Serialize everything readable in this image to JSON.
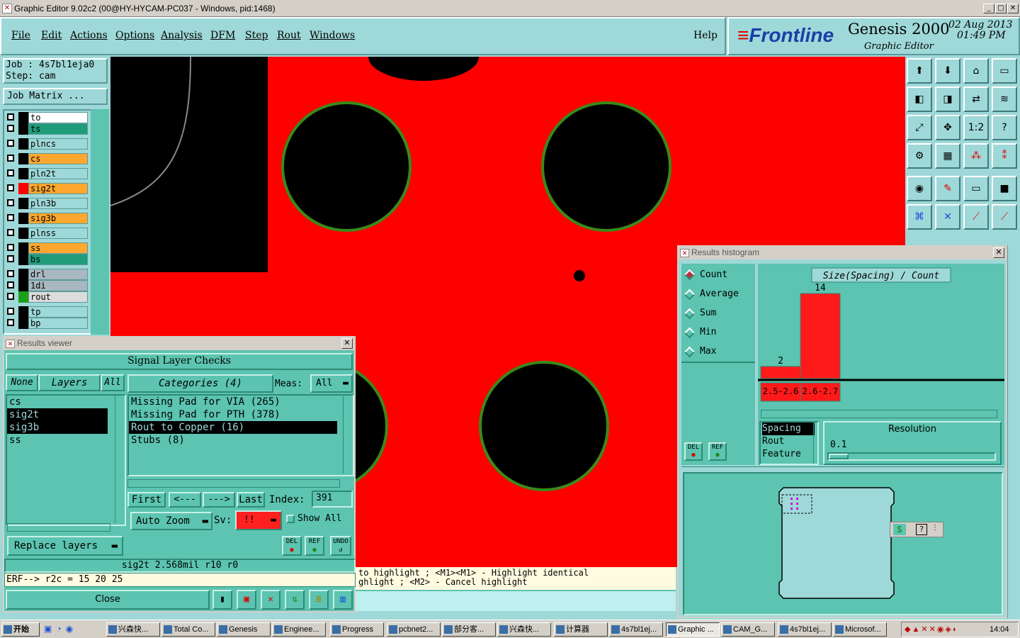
{
  "window": {
    "title": "Graphic Editor 9.02c2 (00@HY-HYCAM-PC037 - Windows, pid:1468)",
    "min": "_",
    "max": "□",
    "close": "✕"
  },
  "menu": {
    "items": [
      "File",
      "Edit",
      "Actions",
      "Options",
      "Analysis",
      "DFM",
      "Step",
      "Rout",
      "Windows"
    ],
    "help": "Help"
  },
  "brand": {
    "logo": "Frontline",
    "product": "Genesis 2000",
    "subtitle": "Graphic Editor",
    "date": "02  Aug 2013",
    "time": "01:49  PM"
  },
  "job": {
    "job_label": "Job : 4s7bl1eja0",
    "step_label": "Step: cam",
    "matrix_button": "Job Matrix ..."
  },
  "layers": [
    {
      "name": "to",
      "bg": "#ffffff",
      "swatch": "#000000"
    },
    {
      "name": "ts",
      "bg": "#1f9c7a",
      "swatch": "#000000"
    },
    {
      "name": "plncs",
      "bg": "#9fd8d8",
      "swatch": "#000000"
    },
    {
      "name": "cs",
      "bg": "#ffa72e",
      "swatch": "#000000"
    },
    {
      "name": "pln2t",
      "bg": "#9fd8d8",
      "swatch": "#000000"
    },
    {
      "name": "sig2t",
      "bg": "#ffa72e",
      "swatch": "#ff0000"
    },
    {
      "name": "pln3b",
      "bg": "#9fd8d8",
      "swatch": "#000000"
    },
    {
      "name": "sig3b",
      "bg": "#ffa72e",
      "swatch": "#000000"
    },
    {
      "name": "plnss",
      "bg": "#9fd8d8",
      "swatch": "#000000"
    },
    {
      "name": "ss",
      "bg": "#ffa72e",
      "swatch": "#000000"
    },
    {
      "name": "bs",
      "bg": "#1f9c7a",
      "swatch": "#000000"
    },
    {
      "name": "drl",
      "bg": "#a8b8c0",
      "swatch": "#000000"
    },
    {
      "name": "1di",
      "bg": "#a8b8c0",
      "swatch": "#000000"
    },
    {
      "name": "rout",
      "bg": "#dcdcdc",
      "swatch": "#1aa01a"
    },
    {
      "name": "tp",
      "bg": "#9fd8d8",
      "swatch": "#000000"
    },
    {
      "name": "bp",
      "bg": "#9fd8d8",
      "swatch": "#000000"
    }
  ],
  "results_viewer": {
    "title": "Results viewer",
    "heading": "Signal Layer Checks",
    "none_btn": "None",
    "layers_btn": "Layers",
    "all_btn": "All",
    "categories_btn": "Categories (4)",
    "meas_label": "Meas:",
    "meas_value": "All",
    "layer_list": [
      "cs",
      "sig2t",
      "sig3b",
      "ss"
    ],
    "categories": [
      "Missing Pad for VIA (265)",
      "Missing Pad for PTH (378)",
      "Rout to Copper (16)",
      "Stubs (8)"
    ],
    "first": "First",
    "prev": "<---",
    "next": "--->",
    "last": "Last",
    "index_label": "Index:",
    "index_value": "391",
    "auto_zoom": "Auto Zoom",
    "sv_label": "Sv:",
    "sv_value": "!!",
    "show_all": "Show All",
    "replace_layers": "Replace layers",
    "del": "DEL",
    "ref": "REF",
    "undo": "UNDO",
    "status": "sig2t 2.568mil   r10   r0",
    "cmd": "ERF--> r2c = 15 20 25",
    "close": "Close"
  },
  "hints": {
    "line1": "to highlight ; <M1><M1> - Highlight identical",
    "line2": "ghlight ; <M2> - Cancel highlight"
  },
  "histogram": {
    "title": "Results histogram",
    "modes": [
      "Count",
      "Average",
      "Sum",
      "Min",
      "Max"
    ],
    "selected_mode": "Count",
    "chart_title": "Size(Spacing) / Count",
    "del": "DEL",
    "ref": "REF",
    "list": [
      "Spacing",
      "Rout",
      "Feature"
    ],
    "resolution_label": "Resolution",
    "resolution_value": "0.1"
  },
  "chart_data": {
    "type": "bar",
    "title": "Size(Spacing) / Count",
    "categories": [
      "2.5-2.6",
      "2.6-2.7"
    ],
    "values": [
      2,
      14
    ]
  },
  "taskbar": {
    "start": "开始",
    "tasks": [
      "兴森快...",
      "Total Co...",
      "Genesis",
      "Enginee...",
      "Progress",
      "pcbnet2...",
      "部分客...",
      "兴森快...",
      "计算器",
      "4s7bl1ej...",
      "Graphic ...",
      "CAM_G...",
      "4s7bl1ej...",
      "Microsof..."
    ],
    "clock": "14:04"
  }
}
